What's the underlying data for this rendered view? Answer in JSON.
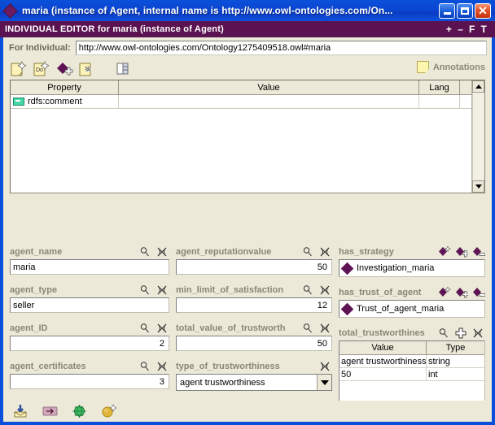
{
  "window": {
    "title": "maria   (instance of Agent, internal name is http://www.owl-ontologies.com/On...",
    "icon": "diamond-icon",
    "controls": {
      "minimize": "minimize-icon",
      "maximize": "maximize-icon",
      "close": "close-icon"
    }
  },
  "editor_header": {
    "title": "INDIVIDUAL EDITOR for maria   (instance of Agent)",
    "buttons": [
      {
        "name": "plus",
        "label": "+"
      },
      {
        "name": "minus",
        "label": "–"
      },
      {
        "name": "float",
        "label": "F"
      },
      {
        "name": "tear",
        "label": "T"
      }
    ]
  },
  "for_individual": {
    "label": "For Individual:",
    "value": "http://www.owl-ontologies.com/Ontology1275409518.owl#maria",
    "placeholder": ""
  },
  "toolbar": {
    "icons": [
      {
        "name": "create-annotation-icon",
        "title": "Create annotation"
      },
      {
        "name": "create-documentation-icon",
        "title": "Create documentation"
      },
      {
        "name": "add-individual-annotation-icon",
        "title": "Add individual annotation"
      },
      {
        "name": "delete-annotation-icon",
        "title": "Delete annotation"
      },
      {
        "name": "view-properties-icon",
        "title": "View properties"
      }
    ],
    "annotations_label": "Annotations",
    "annotations_icon": "note-icon"
  },
  "annotations_table": {
    "columns": [
      "Property",
      "Value",
      "Lang"
    ],
    "rows": [
      {
        "icon": "annotation-property-icon",
        "property": "rdfs:comment",
        "value": "",
        "lang": ""
      }
    ],
    "scrollbar": {
      "up": "scroll-up-icon",
      "down": "scroll-down-icon"
    }
  },
  "properties": {
    "left": [
      {
        "label": "agent_name",
        "type": "text",
        "value": "maria",
        "align": "left",
        "icons": [
          "magnifier-icon",
          "delete-icon"
        ]
      },
      {
        "label": "agent_type",
        "type": "text",
        "value": "seller",
        "align": "left",
        "icons": [
          "magnifier-icon",
          "delete-icon"
        ]
      },
      {
        "label": "agent_ID",
        "type": "text",
        "value": "2",
        "align": "right",
        "icons": [
          "magnifier-icon",
          "delete-icon"
        ]
      },
      {
        "label": "agent_certificates",
        "type": "text",
        "value": "3",
        "align": "right",
        "icons": [
          "magnifier-icon",
          "delete-icon"
        ]
      }
    ],
    "mid": [
      {
        "label": "agent_reputationvalue",
        "type": "text",
        "value": "50",
        "align": "right",
        "icons": [
          "magnifier-icon",
          "delete-icon"
        ]
      },
      {
        "label": "min_limit_of_satisfaction",
        "type": "text",
        "value": "12",
        "align": "right",
        "icons": [
          "magnifier-icon",
          "delete-icon"
        ]
      },
      {
        "label": "total_value_of_trustworth",
        "type": "text",
        "value": "50",
        "align": "right",
        "icons": [
          "magnifier-icon",
          "delete-icon"
        ]
      },
      {
        "label": "type_of_trustworthiness",
        "type": "combo",
        "value": "agent trustworthiness",
        "icons": [
          "delete-icon"
        ]
      }
    ],
    "right": [
      {
        "label": "has_strategy",
        "type": "instance-list",
        "value": "Investigation_maria",
        "icons": [
          "create-instance-icon",
          "add-instance-icon",
          "remove-instance-icon"
        ]
      },
      {
        "label": "has_trust_of_agent",
        "type": "instance-list",
        "value": "Trust_of_agent_maria",
        "icons": [
          "create-instance-icon",
          "add-instance-icon",
          "remove-instance-icon"
        ]
      },
      {
        "label": "total_trustworthines",
        "type": "table",
        "icons": [
          "magnifier-icon",
          "add-icon",
          "delete-icon"
        ],
        "columns": [
          "Value",
          "Type"
        ],
        "rows": [
          {
            "value": "agent trustworthiness",
            "type": "string"
          },
          {
            "value": "50",
            "type": "int"
          }
        ]
      }
    ]
  },
  "bottom_toolbar": {
    "icons": [
      {
        "name": "import-icon"
      },
      {
        "name": "arrow-right-icon"
      },
      {
        "name": "globe-icon"
      },
      {
        "name": "sphere-new-icon"
      }
    ]
  },
  "colors": {
    "titlebar": "#0a46d2",
    "header_purple": "#5a1250",
    "panel": "#ece9d8",
    "label_gray": "#8a8778",
    "diamond_purple": "#5e1355"
  }
}
